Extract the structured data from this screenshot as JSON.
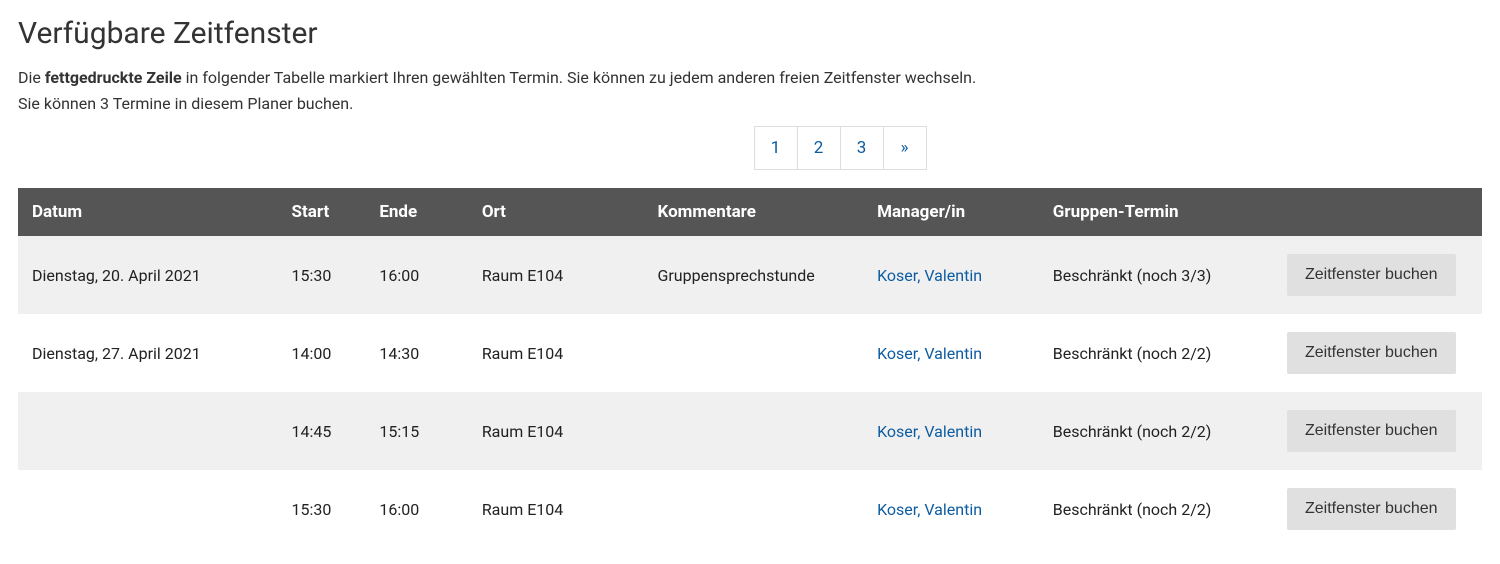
{
  "heading": "Verfügbare Zeitfenster",
  "description": {
    "prefix": "Die ",
    "bold": "fettgedruckte Zeile",
    "line1_rest": " in folgender Tabelle markiert Ihren gewählten Termin. Sie können zu jedem anderen freien Zeitfenster wechseln.",
    "line2": "Sie können 3 Termine in diesem Planer buchen."
  },
  "pagination": {
    "pages": [
      "1",
      "2",
      "3"
    ],
    "next_symbol": "»"
  },
  "table": {
    "headers": {
      "date": "Datum",
      "start": "Start",
      "end": "Ende",
      "location": "Ort",
      "comments": "Kommentare",
      "manager": "Manager/in",
      "group": "Gruppen-Termin"
    },
    "book_label": "Zeitfenster buchen",
    "rows": [
      {
        "date": "Dienstag, 20. April 2021",
        "start": "15:30",
        "end": "16:00",
        "location": "Raum E104",
        "comments": "Gruppensprechstunde",
        "manager": "Koser, Valentin",
        "group": "Beschränkt (noch 3/3)"
      },
      {
        "date": "Dienstag, 27. April 2021",
        "start": "14:00",
        "end": "14:30",
        "location": "Raum E104",
        "comments": "",
        "manager": "Koser, Valentin",
        "group": "Beschränkt (noch 2/2)"
      },
      {
        "date": "",
        "start": "14:45",
        "end": "15:15",
        "location": "Raum E104",
        "comments": "",
        "manager": "Koser, Valentin",
        "group": "Beschränkt (noch 2/2)"
      },
      {
        "date": "",
        "start": "15:30",
        "end": "16:00",
        "location": "Raum E104",
        "comments": "",
        "manager": "Koser, Valentin",
        "group": "Beschränkt (noch 2/2)"
      }
    ]
  }
}
